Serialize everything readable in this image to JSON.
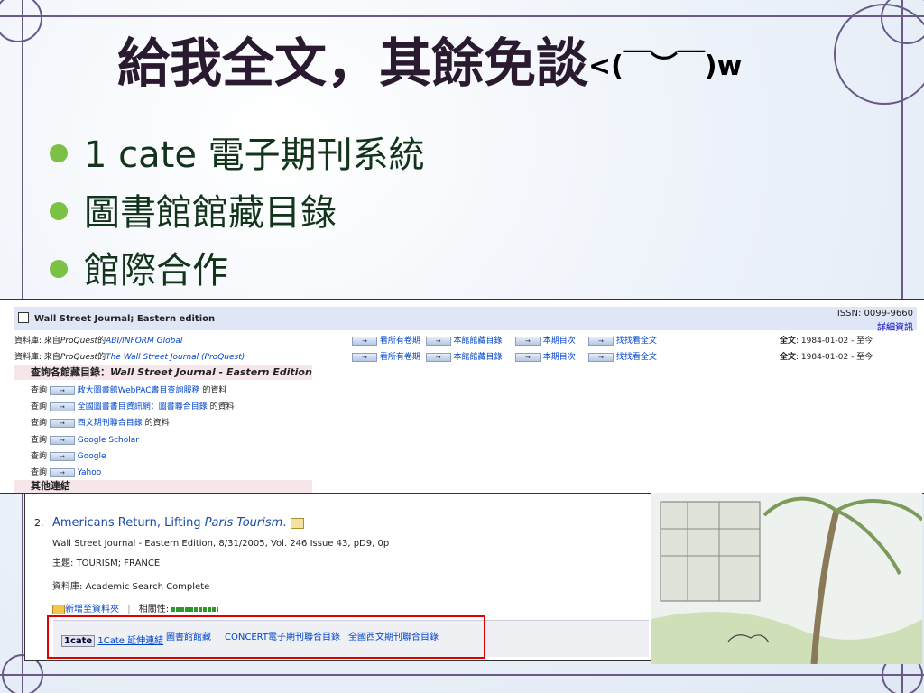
{
  "slide": {
    "title": "給我全文，其餘免談",
    "title_emoticon": "<(￣︶￣)w",
    "bullets": [
      "1 cate 電子期刊系統",
      "圖書館館藏目錄",
      "館際合作"
    ]
  },
  "shot1": {
    "journal_title": "Wall Street Journal; Eastern edition",
    "issn": "ISSN: 0099-9660",
    "detail_link": "詳細資訊",
    "rows": [
      {
        "prefix": "資料庫: 來自",
        "provider": "ProQuest",
        "of": "的",
        "source": "ABI/INFORM Global",
        "links": [
          "看所有卷期",
          "本館館藏目錄",
          "本期目次",
          "找找看全文"
        ],
        "fulltext_label": "全文",
        "fulltext_range": ": 1984-01-02 - 至今"
      },
      {
        "prefix": "資料庫: 來自",
        "provider": "ProQuest",
        "of": "的",
        "source": "The Wall Street Journal (ProQuest)",
        "links": [
          "看所有卷期",
          "本館館藏目錄",
          "本期目次",
          "找找看全文"
        ],
        "fulltext_label": "全文",
        "fulltext_range": ": 1984-01-02 - 至今"
      }
    ],
    "catalog_heading_prefix": "查詢各館藏目錄：",
    "catalog_heading_title": "Wall Street Journal - Eastern Edition",
    "query_label": "查詢",
    "queries": [
      {
        "link": "政大圖書館WebPAC書目查詢服務",
        "suffix": "的資料"
      },
      {
        "link": "全國圖書書目資訊網：圖書聯合目錄",
        "suffix": "的資料"
      },
      {
        "link": "西文期刊聯合目錄",
        "suffix": "的資料"
      },
      {
        "link": "Google Scholar",
        "suffix": ""
      },
      {
        "link": "Google",
        "suffix": ""
      },
      {
        "link": "Yahoo",
        "suffix": ""
      }
    ],
    "other_links_heading": "其他連結"
  },
  "shot2": {
    "number": "2.",
    "title_a": "Americans Return, Lifting ",
    "title_b": "Paris Tourism",
    "title_c": ".",
    "citation": "Wall Street Journal - Eastern Edition, 8/31/2005, Vol. 246 Issue 43, pD9, 0p",
    "subject_label": "主題:",
    "subject": "TOURISM; FRANCE",
    "database_label": "資料庫:",
    "database": "Academic Search Complete",
    "add_folder": "新增至資料夾",
    "relevance_label": "相關性:",
    "cate_logo": "1cate",
    "cate_link": "1Cate 延伸連結",
    "links": [
      "圖書館館藏",
      "CONCERT電子期刊聯合目錄",
      "全國西文期刊聯合目錄"
    ]
  },
  "colors": {
    "bullet": "#7bc143",
    "link": "#0044cc",
    "highlight_box": "#e00000",
    "header_band": "#dfe6f6"
  }
}
